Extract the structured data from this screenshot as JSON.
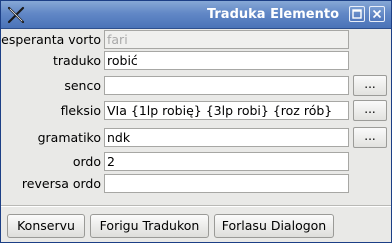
{
  "window": {
    "title": "Traduka Elemento",
    "icon": "x-app-icon"
  },
  "fields": [
    {
      "label": "esperanta vorto",
      "value": "fari",
      "placeholder_style": true
    },
    {
      "label": "traduko",
      "value": "robić"
    },
    {
      "label": "senco",
      "value": "",
      "button_label": "..."
    },
    {
      "label": "fleksio",
      "value": "VIa {1lp robię} {3lp robi} {roz rób}",
      "button_label": "..."
    },
    {
      "label": "gramatiko",
      "value": "ndk",
      "button_label": "..."
    },
    {
      "label": "ordo",
      "value": "2"
    },
    {
      "label": "reversa ordo",
      "value": ""
    }
  ],
  "buttons": {
    "save": "Konservu",
    "delete": "Forigu Tradukon",
    "close": "Forlasu Dialogon"
  }
}
